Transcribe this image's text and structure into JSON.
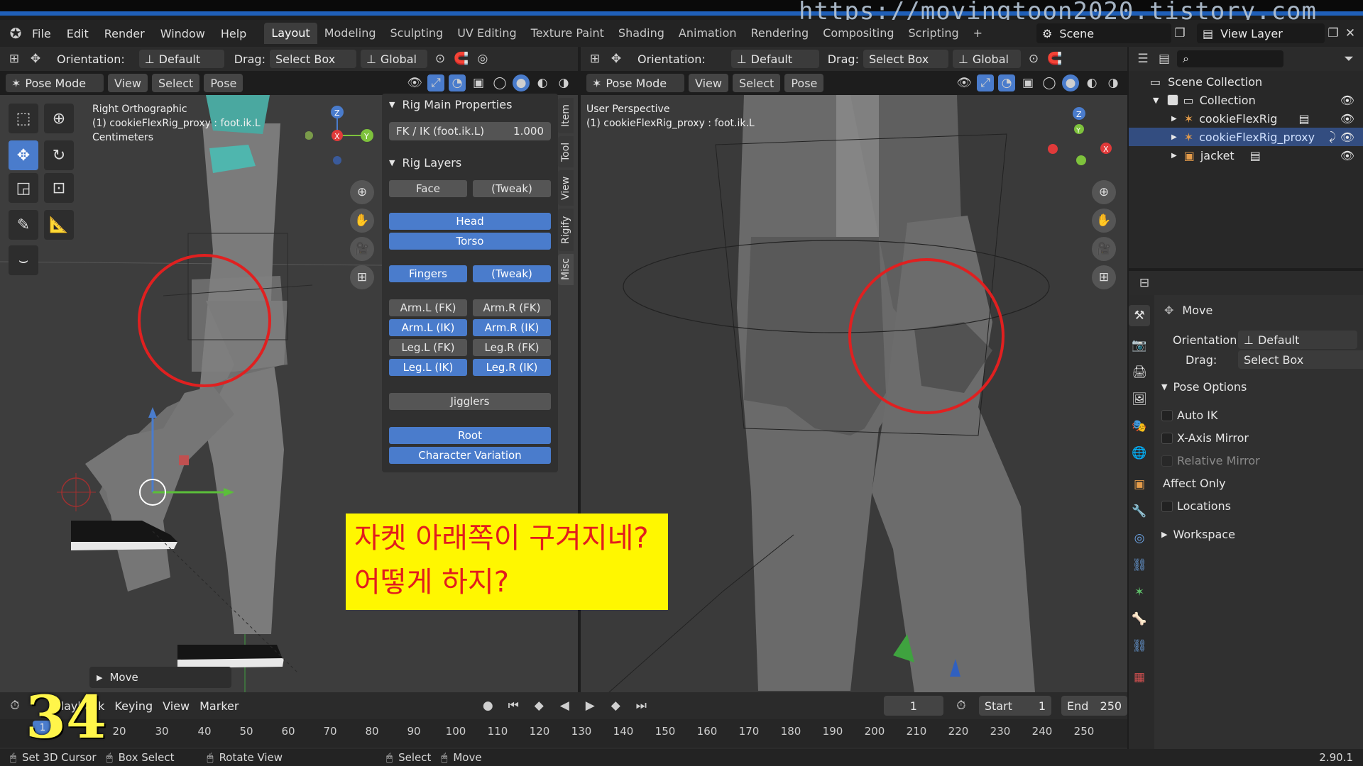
{
  "watermark": "https://movingtoon2020.tistory.com",
  "menubar": {
    "menus": [
      "File",
      "Edit",
      "Render",
      "Window",
      "Help"
    ],
    "workspaces": [
      "Layout",
      "Modeling",
      "Sculpting",
      "UV Editing",
      "Texture Paint",
      "Shading",
      "Animation",
      "Rendering",
      "Compositing",
      "Scripting"
    ],
    "active_workspace": "Layout",
    "add_tab": "+",
    "scene": "Scene",
    "view_layer": "View Layer"
  },
  "left_viewport": {
    "orientation_label": "Orientation:",
    "orientation_value": "Default",
    "drag_label": "Drag:",
    "drag_value": "Select Box",
    "transform_space": "Global",
    "mode": "Pose Mode",
    "menu_view": "View",
    "menu_select": "Select",
    "menu_pose": "Pose",
    "info_line1": "Right Orthographic",
    "info_line2": "(1) cookieFlexRig_proxy : foot.ik.L",
    "info_line3": "Centimeters",
    "last_op": "Move"
  },
  "npanel": {
    "main_props_title": "Rig Main Properties",
    "fkik_label": "FK / IK (foot.ik.L)",
    "fkik_value": "1.000",
    "rig_layers_title": "Rig Layers",
    "tabs": [
      "Item",
      "Tool",
      "View",
      "Rigify",
      "Misc"
    ],
    "buttons": {
      "face": "Face",
      "tweak1": "(Tweak)",
      "head": "Head",
      "torso": "Torso",
      "fingers": "Fingers",
      "tweak2": "(Tweak)",
      "arml_fk": "Arm.L (FK)",
      "armr_fk": "Arm.R (FK)",
      "arml_ik": "Arm.L (IK)",
      "armr_ik": "Arm.R (IK)",
      "legl_fk": "Leg.L (FK)",
      "legr_fk": "Leg.R (FK)",
      "legl_ik": "Leg.L (IK)",
      "legr_ik": "Leg.R (IK)",
      "jigglers": "Jigglers",
      "root": "Root",
      "charvar": "Character Variation"
    }
  },
  "right_viewport": {
    "orientation_label": "Orientation:",
    "orientation_value": "Default",
    "drag_label": "Drag:",
    "drag_value": "Select Box",
    "transform_space": "Global",
    "mode": "Pose Mode",
    "menu_view": "View",
    "menu_select": "Select",
    "menu_pose": "Pose",
    "info_line1": "User Perspective",
    "info_line2": "(1) cookieFlexRig_proxy : foot.ik.L"
  },
  "outliner": {
    "scene_collection": "Scene Collection",
    "collection": "Collection",
    "items": [
      "cookieFlexRig",
      "cookieFlexRig_proxy",
      "jacket"
    ]
  },
  "properties": {
    "tool_title": "Move",
    "orientation_label": "Orientation",
    "orientation_value": "Default",
    "drag_label": "Drag:",
    "drag_value": "Select Box",
    "pose_options": "Pose Options",
    "auto_ik": "Auto IK",
    "x_mirror": "X-Axis Mirror",
    "relative_mirror": "Relative Mirror",
    "affect_only": "Affect Only",
    "locations": "Locations",
    "workspace": "Workspace"
  },
  "timeline": {
    "playback": "Playback",
    "keying": "Keying",
    "view": "View",
    "marker": "Marker",
    "current_frame": "1",
    "start_label": "Start",
    "start_value": "1",
    "end_label": "End",
    "end_value": "250",
    "ruler_labels": [
      "1",
      "20",
      "30",
      "40",
      "50",
      "60",
      "70",
      "80",
      "90",
      "100",
      "110",
      "120",
      "130",
      "140",
      "150",
      "160",
      "170",
      "180",
      "190",
      "200",
      "210",
      "220",
      "230",
      "240",
      "250"
    ]
  },
  "statusbar": {
    "set_cursor": "Set 3D Cursor",
    "box_select": "Box Select",
    "rotate_view": "Rotate View",
    "select": "Select",
    "move": "Move",
    "version": "2.90.1"
  },
  "annotation": {
    "line1": "자켓 아래쪽이 구겨지네?",
    "line2": "어떻게 하지?"
  },
  "slide_number": "34",
  "colors": {
    "accent": "#4a7ccc",
    "highlight_circle": "#e02020",
    "annotation_bg": "#fff700",
    "annotation_text": "#e21d1d"
  }
}
